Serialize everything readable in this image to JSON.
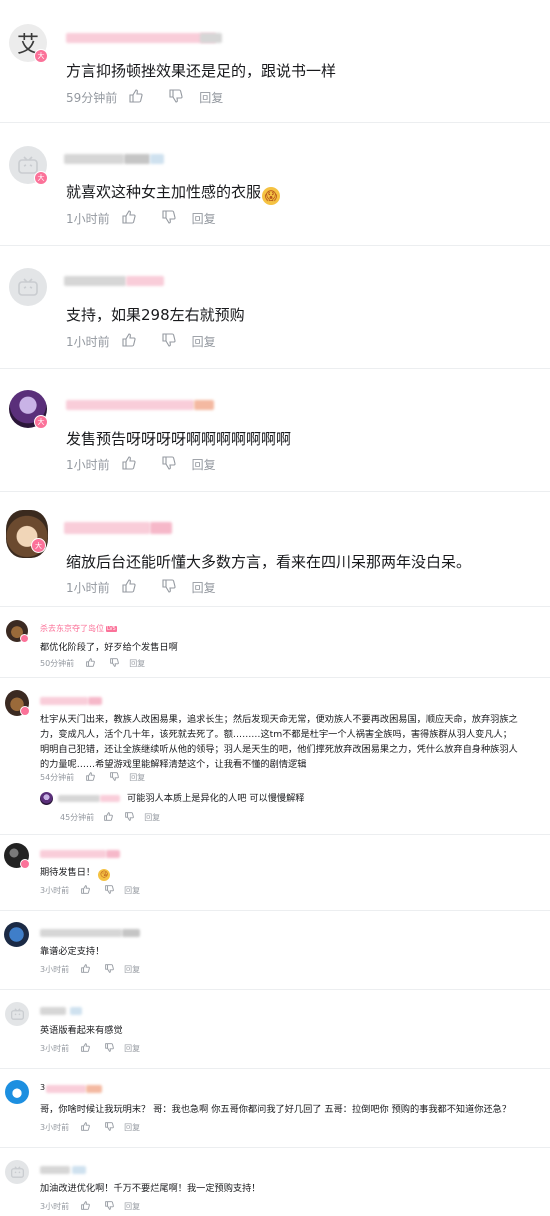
{
  "comments": [
    {
      "text": "方言抑扬顿挫效果还是足的，跟说书一样",
      "time": "59分钟前",
      "reply": "回复",
      "avatar_char": "艾",
      "badge": "大"
    },
    {
      "text": "就喜欢这种女主加性感的衣服",
      "time": "1小时前",
      "reply": "回复",
      "badge": "大"
    },
    {
      "text": "支持，如果298左右就预购",
      "time": "1小时前",
      "reply": "回复"
    },
    {
      "text": "发售预告呀呀呀呀啊啊啊啊啊啊啊",
      "time": "1小时前",
      "reply": "回复",
      "badge": "大"
    },
    {
      "text": "缩放后台还能听懂大多数方言，看来在四川呆那两年没白呆。",
      "time": "1小时前",
      "reply": "回复",
      "badge": "大"
    }
  ],
  "small_comments": [
    {
      "username": "杀去东京夺了岛位",
      "lv": "LV5",
      "text": "都优化阶段了，好歹给个发售日啊",
      "time": "50分钟前",
      "reply": "回复"
    },
    {
      "text": "杜宇从天门出来，教族人改困易果，追求长生；然后发现天命无常，便劝族人不要再改困易国，顺应天命，放弃羽族之力，变成凡人，活个几十年，该死就去死了。额………这tm不都是杜宇一个人祸害全族吗，害得族群从羽人变凡人；明明自己犯错，还让全族继续听从他的领导；羽人是天生的吧，他们撑死放弃改困易果之力，凭什么放弃自身种族羽人的力量呢……希望游戏里能解释清楚这个，让我看不懂的剧情逻辑",
      "time": "54分钟前",
      "reply": "回复"
    },
    {
      "text": "期待发售日！",
      "time": "3小时前",
      "reply": "回复"
    },
    {
      "text": "靠谱必定支持！",
      "time": "3小时前",
      "reply": "回复"
    },
    {
      "text": "英语版看起来有感觉",
      "time": "3小时前",
      "reply": "回复"
    },
    {
      "text": "哥，你啥时候让我玩明末？ 哥：我也急啊 你五哥你都问我了好几回了 五哥：拉倒吧你 预购的事我都不知道你还急？",
      "time": "3小时前",
      "reply": "回复",
      "name_initial": "3"
    },
    {
      "text": "加油改进优化啊！千万不要烂尾啊！我一定预购支持！",
      "time": "3小时前",
      "reply": "回复"
    }
  ],
  "sub_reply": {
    "text": "可能羽人本质上是异化的人吧 可以慢慢解释",
    "time": "45分钟前",
    "reply": "回复"
  },
  "icons": {
    "like": "thumbs-up-icon",
    "dislike": "thumbs-down-icon",
    "default_avatar": "bilibili-tv-icon"
  },
  "colors": {
    "accent": "#fb7299",
    "meta": "#9499a0",
    "text": "#18191c"
  }
}
